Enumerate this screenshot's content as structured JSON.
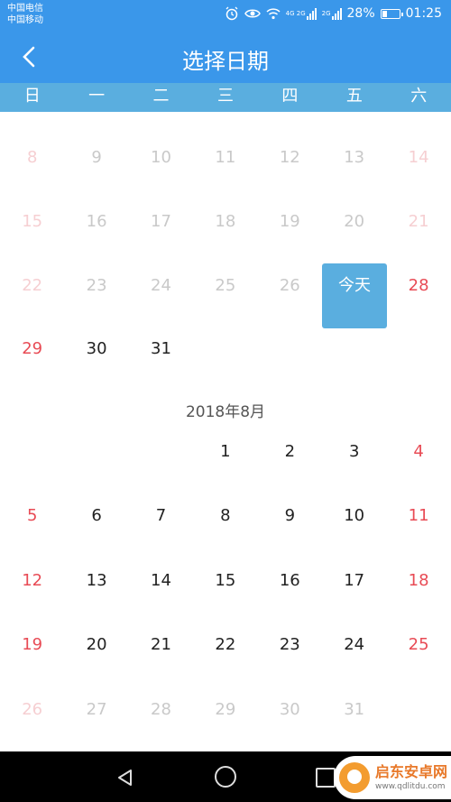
{
  "status_bar": {
    "carrier_1": "中国电信",
    "carrier_2": "中国移动",
    "network_1": "4G 2G",
    "network_2": "2G",
    "battery": "28%",
    "time": "01:25"
  },
  "app_bar": {
    "title": "选择日期",
    "back_icon": "chevron-left-icon"
  },
  "weekdays": [
    "日",
    "一",
    "二",
    "三",
    "四",
    "五",
    "六"
  ],
  "previous_month": {
    "rows": [
      [
        "8",
        "9",
        "10",
        "11",
        "12",
        "13",
        "14"
      ],
      [
        "15",
        "16",
        "17",
        "18",
        "19",
        "20",
        "21"
      ],
      [
        "22",
        "23",
        "24",
        "25",
        "26",
        "今天",
        "28"
      ],
      [
        "29",
        "30",
        "31",
        "",
        "",
        "",
        ""
      ]
    ]
  },
  "current_month": {
    "title": "2018年8月",
    "rows": [
      [
        "",
        "",
        "",
        "1",
        "2",
        "3",
        "4"
      ],
      [
        "5",
        "6",
        "7",
        "8",
        "9",
        "10",
        "11"
      ],
      [
        "12",
        "13",
        "14",
        "15",
        "16",
        "17",
        "18"
      ],
      [
        "19",
        "20",
        "21",
        "22",
        "23",
        "24",
        "25"
      ],
      [
        "26",
        "27",
        "28",
        "29",
        "30",
        "31",
        ""
      ]
    ]
  },
  "today_label": "今天",
  "watermark": {
    "line1": "启东安卓网",
    "line2": "www.qdlitdu.com"
  },
  "colors": {
    "accent": "#3a97ea",
    "weekbar": "#5aaedf",
    "weekend": "#e84b55"
  }
}
